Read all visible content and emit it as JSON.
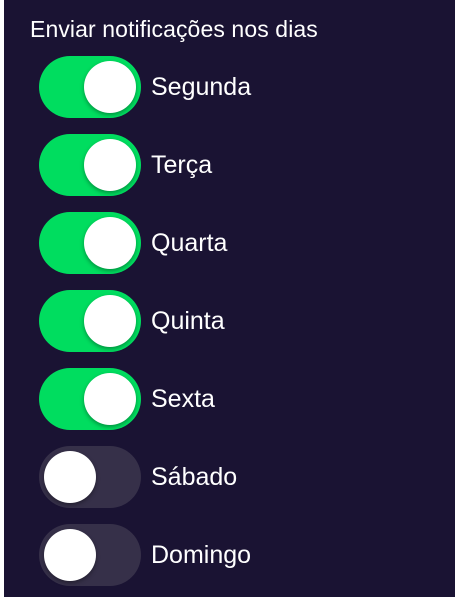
{
  "colors": {
    "background": "#1a1333",
    "toggle_on": "#00dd5f",
    "toggle_off": "#363049",
    "knob": "#ffffff",
    "text": "#ffffff"
  },
  "title": "Enviar notificações nos dias",
  "days": [
    {
      "label": "Segunda",
      "enabled": true
    },
    {
      "label": "Terça",
      "enabled": true
    },
    {
      "label": "Quarta",
      "enabled": true
    },
    {
      "label": "Quinta",
      "enabled": true
    },
    {
      "label": "Sexta",
      "enabled": true
    },
    {
      "label": "Sábado",
      "enabled": false
    },
    {
      "label": "Domingo",
      "enabled": false
    }
  ]
}
